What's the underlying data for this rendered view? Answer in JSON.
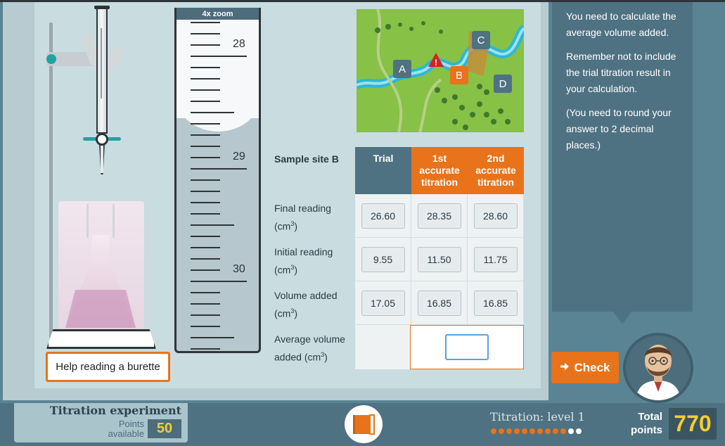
{
  "colors": {
    "accent_orange": "#e8731a",
    "panel_teal": "#4f7282",
    "points_yellow": "#f1d032",
    "water_blue": "#2bb8d6"
  },
  "help_button_label": "Help reading a burette",
  "zoom": {
    "label": "4x zoom",
    "scale_labels": [
      "28",
      "29",
      "30"
    ]
  },
  "map": {
    "markers": [
      "A",
      "B",
      "C",
      "D"
    ],
    "warning_icon": "warning-triangle-icon"
  },
  "table": {
    "sample_title": "Sample site B",
    "columns": [
      "Trial",
      "1st accurate titration",
      "2nd accurate titration"
    ],
    "rows": [
      {
        "label": "Final reading",
        "unit": "(cm",
        "values": [
          "26.60",
          "28.35",
          "28.60"
        ]
      },
      {
        "label": "Initial reading",
        "unit": "(cm",
        "values": [
          "9.55",
          "11.50",
          "11.75"
        ]
      },
      {
        "label": "Volume added",
        "unit": "(cm",
        "values": [
          "17.05",
          "16.85",
          "16.85"
        ]
      }
    ],
    "average_label": "Average volume added (cm",
    "superscript": "3",
    "close_paren": ")",
    "average_value": ""
  },
  "instructions": [
    "You need to calculate the average volume added.",
    "Remember not to include the trial titration result in your calculation.",
    "(You need to round your answer to 2 decimal places.)"
  ],
  "check_button_label": "Check",
  "footer": {
    "game_title": "Titration experiment",
    "points_available_label": "Points available",
    "points_available_value": "50",
    "level_label": "Titration: level 1",
    "progress": {
      "completed": 10,
      "total": 12
    },
    "total_points_label": "Total points",
    "total_points_value": "770"
  }
}
